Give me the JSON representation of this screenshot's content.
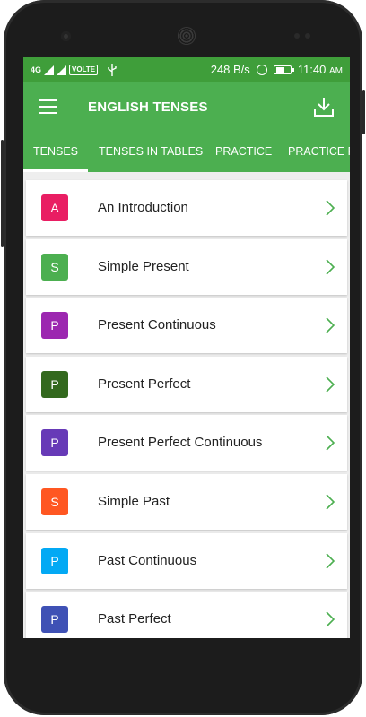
{
  "status": {
    "network": "4G",
    "volte": "VOLTE",
    "speed": "248 B/s",
    "time": "11:40",
    "ampm": "AM",
    "battery_level": 0.7
  },
  "toolbar": {
    "title": "ENGLISH TENSES"
  },
  "tabs": [
    {
      "label": "TENSES"
    },
    {
      "label": "TENSES IN TABLES"
    },
    {
      "label": "PRACTICE"
    },
    {
      "label": "PRACTICE FI"
    }
  ],
  "items": [
    {
      "letter": "A",
      "label": "An Introduction",
      "color": "#e91e63"
    },
    {
      "letter": "S",
      "label": "Simple Present",
      "color": "#4caf50"
    },
    {
      "letter": "P",
      "label": "Present Continuous",
      "color": "#9c27b0"
    },
    {
      "letter": "P",
      "label": "Present Perfect",
      "color": "#33691e"
    },
    {
      "letter": "P",
      "label": "Present Perfect Continuous",
      "color": "#673ab7"
    },
    {
      "letter": "S",
      "label": "Simple Past",
      "color": "#ff5722"
    },
    {
      "letter": "P",
      "label": "Past Continuous",
      "color": "#03a9f4"
    },
    {
      "letter": "P",
      "label": "Past Perfect",
      "color": "#3f51b5"
    }
  ],
  "colors": {
    "primary": "#4caf50",
    "status_bar": "#3f9e3a",
    "chevron": "#4caf50"
  }
}
